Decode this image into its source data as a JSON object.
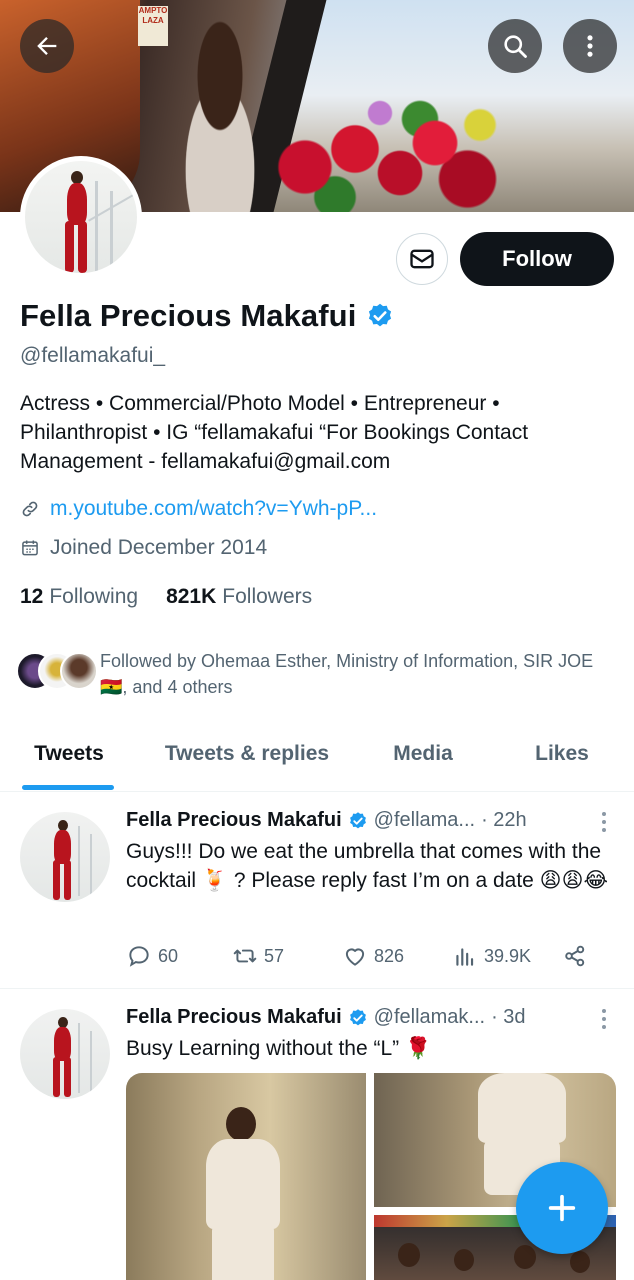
{
  "profile": {
    "name": "Fella Precious Makafui",
    "handle": "@fellamakafui_",
    "bio": "Actress • Commercial/Photo Model • Entrepreneur • Philanthropist • IG “fellamakafui “For Bookings Contact Management - fellamakafui@gmail.com",
    "link": "m.youtube.com/watch?v=Ywh-pP...",
    "joined": "Joined December 2014",
    "following_count": "12",
    "following_label": "Following",
    "followers_count": "821K",
    "followers_label": "Followers",
    "followed_by": "Followed by Ohemaa Esther, Ministry of Information, SIR JOE🇬🇭, and 4 others",
    "follow_label": "Follow"
  },
  "banner": {
    "sign_text": "AMPTO LAZA"
  },
  "header": {
    "back_icon": "back-arrow-icon",
    "search_icon": "search-icon",
    "more_icon": "more-vertical-icon"
  },
  "tabs": [
    {
      "label": "Tweets",
      "active": true
    },
    {
      "label": "Tweets & replies",
      "active": false
    },
    {
      "label": "Media",
      "active": false
    },
    {
      "label": "Likes",
      "active": false
    }
  ],
  "tweets": [
    {
      "name": "Fella Precious Makafui",
      "handle": "@fellama...",
      "time": "· 22h",
      "text": "Guys!!! Do we eat the umbrella that comes with the cocktail 🍹 ? Please reply fast I’m on a date 😩😩😂",
      "replies": "60",
      "retweets": "57",
      "likes": "826",
      "views": "39.9K"
    },
    {
      "name": "Fella Precious Makafui",
      "handle": "@fellamak...",
      "time": "· 3d",
      "text": "Busy Learning without the “L” 🌹"
    }
  ],
  "colors": {
    "accent": "#1d9bf0",
    "text": "#0f1419",
    "muted": "#536471",
    "follow_button": "#0f1419"
  }
}
